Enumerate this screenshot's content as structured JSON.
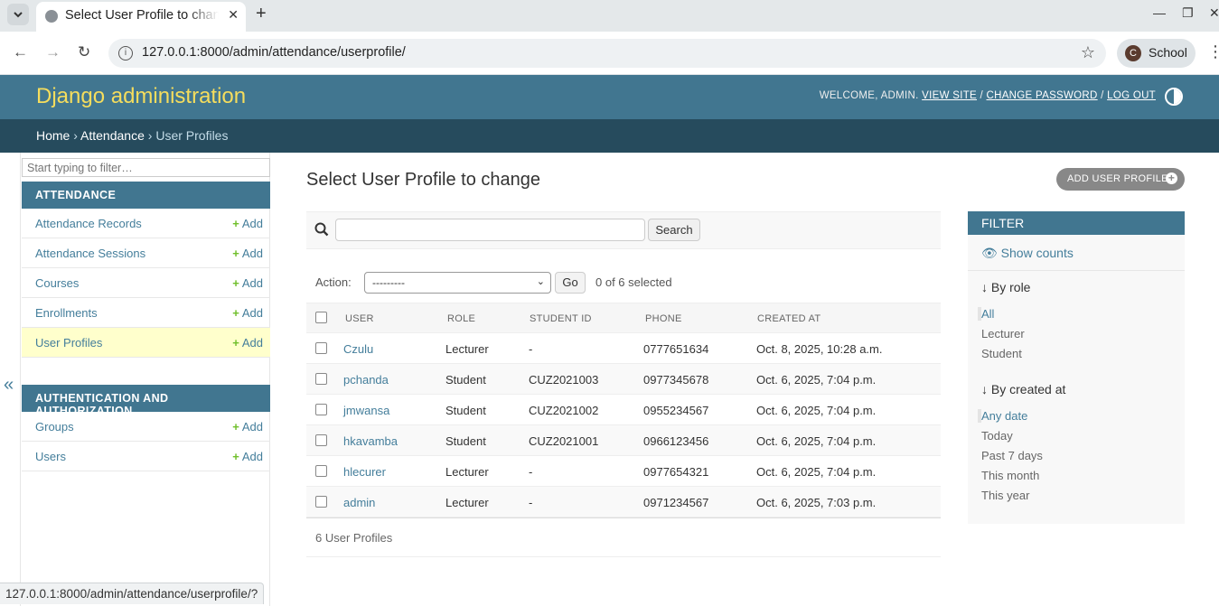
{
  "browser": {
    "tab_title": "Select User Profile to change | Django site admin",
    "url": "127.0.0.1:8000/admin/attendance/userprofile/",
    "profile_initial": "C",
    "profile_name": "School",
    "status_url": "127.0.0.1:8000/admin/attendance/userprofile/?"
  },
  "header": {
    "branding": "Django administration",
    "welcome": "WELCOME, ",
    "username": "ADMIN",
    "view_site": "VIEW SITE",
    "change_password": "CHANGE PASSWORD",
    "log_out": "LOG OUT"
  },
  "breadcrumbs": {
    "home": "Home",
    "app": "Attendance",
    "current": "User Profiles"
  },
  "sidebar": {
    "filter_placeholder": "Start typing to filter…",
    "add_label": "Add",
    "collapse_glyph": "«",
    "modules": [
      {
        "caption": "ATTENDANCE",
        "items": [
          "Attendance Records",
          "Attendance Sessions",
          "Courses",
          "Enrollments",
          "User Profiles"
        ]
      },
      {
        "caption": "AUTHENTICATION AND AUTHORIZATION",
        "items": [
          "Groups",
          "Users"
        ]
      }
    ]
  },
  "content": {
    "title": "Select User Profile to change",
    "add_button": "ADD USER PROFILE",
    "search_button": "Search",
    "action_label": "Action:",
    "action_selected": "---------",
    "go_button": "Go",
    "action_counter": "0 of 6 selected",
    "paginator": "6 User Profiles"
  },
  "table": {
    "headers": [
      "USER",
      "ROLE",
      "STUDENT ID",
      "PHONE",
      "CREATED AT"
    ],
    "rows": [
      [
        "Czulu",
        "Lecturer",
        "-",
        "0777651634",
        "Oct. 8, 2025, 10:28 a.m."
      ],
      [
        "pchanda",
        "Student",
        "CUZ2021003",
        "0977345678",
        "Oct. 6, 2025, 7:04 p.m."
      ],
      [
        "jmwansa",
        "Student",
        "CUZ2021002",
        "0955234567",
        "Oct. 6, 2025, 7:04 p.m."
      ],
      [
        "hkavamba",
        "Student",
        "CUZ2021001",
        "0966123456",
        "Oct. 6, 2025, 7:04 p.m."
      ],
      [
        "hlecurer",
        "Lecturer",
        "-",
        "0977654321",
        "Oct. 6, 2025, 7:04 p.m."
      ],
      [
        "admin",
        "Lecturer",
        "-",
        "0971234567",
        "Oct. 6, 2025, 7:03 p.m."
      ]
    ]
  },
  "filter": {
    "title": "FILTER",
    "show_counts": "Show counts",
    "by_role": "↓ By role",
    "role_options": [
      "All",
      "Lecturer",
      "Student"
    ],
    "by_created": "↓ By created at",
    "created_options": [
      "Any date",
      "Today",
      "Past 7 days",
      "This month",
      "This year"
    ]
  },
  "colors": {
    "header_bg": "#417690",
    "breadcrumb_bg": "#264b5d",
    "branding": "#f5dd5d",
    "link": "#447e9b",
    "current_row": "#ffffcc",
    "add_green": "#70bf2b"
  }
}
